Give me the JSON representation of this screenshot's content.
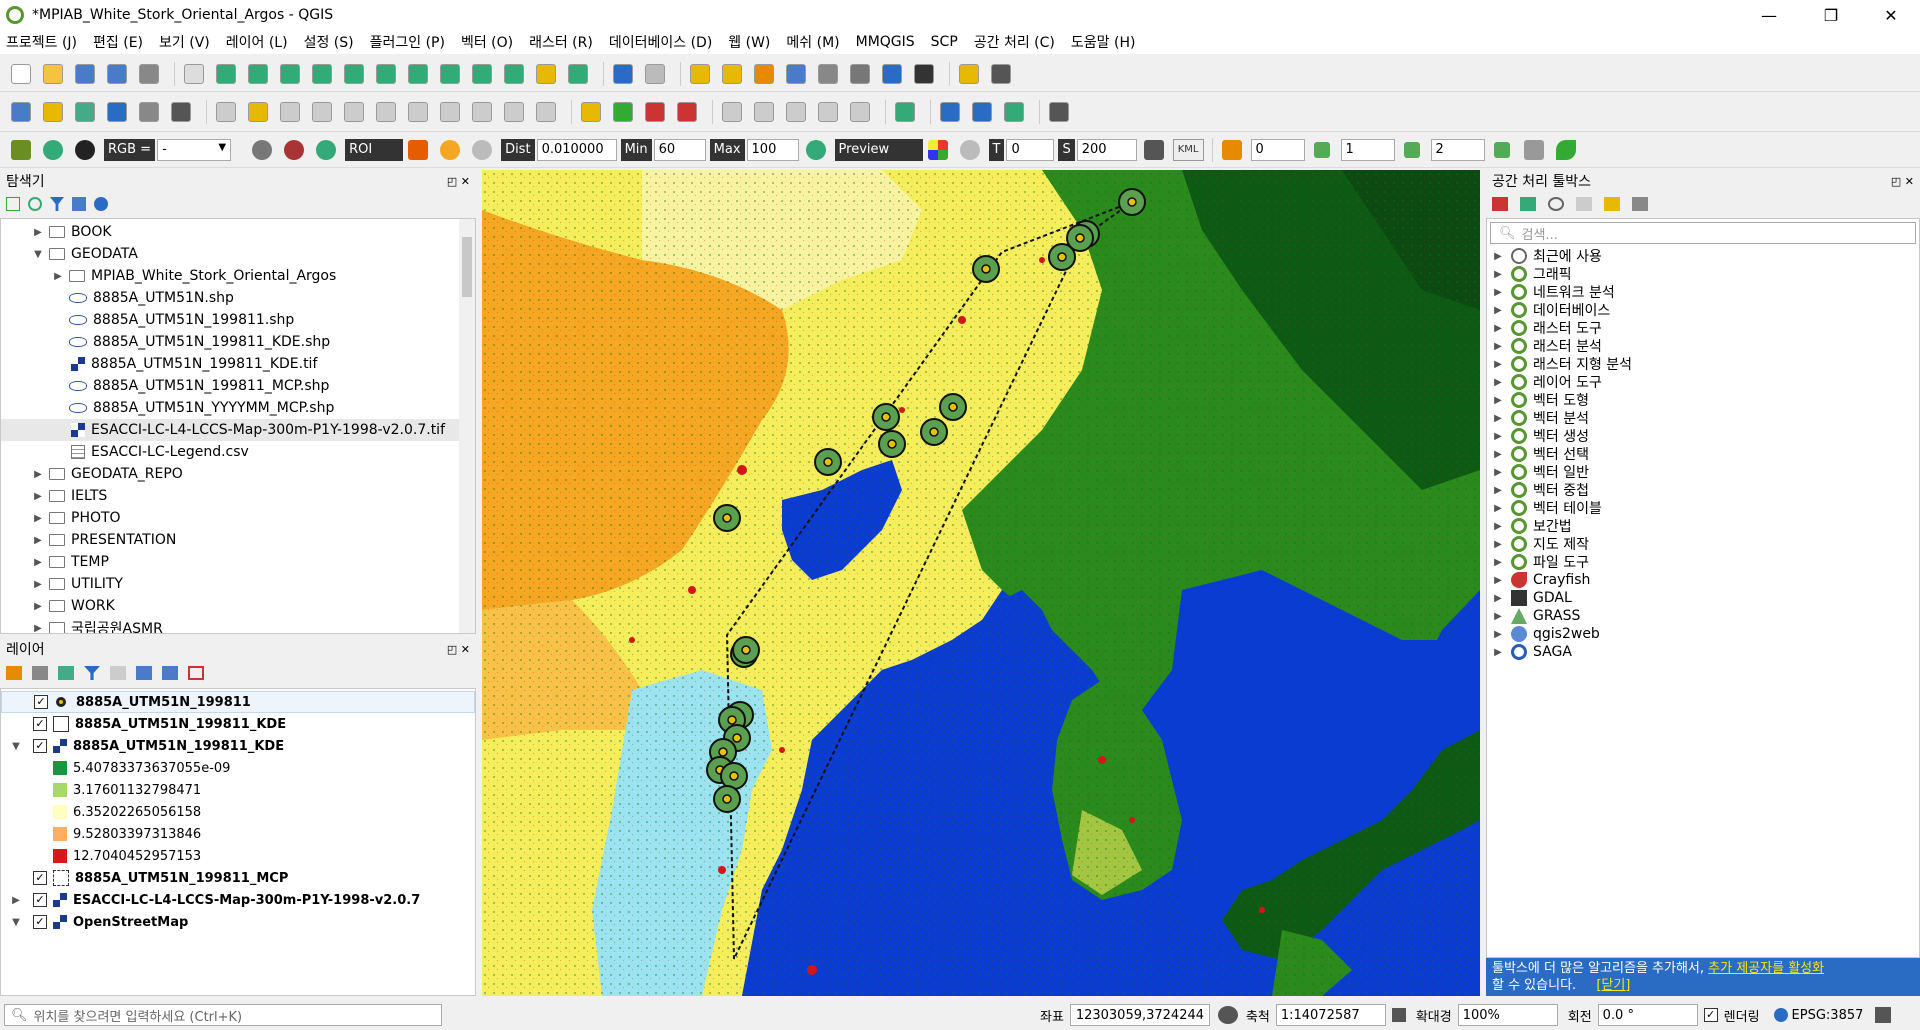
{
  "window": {
    "title": "*MPIAB_White_Stork_Oriental_Argos - QGIS"
  },
  "menu": [
    "프로젝트 (J)",
    "편집 (E)",
    "보기 (V)",
    "레이어 (L)",
    "설정 (S)",
    "플러그인 (P)",
    "벡터 (O)",
    "래스터 (R)",
    "데이터베이스 (D)",
    "웹 (W)",
    "메쉬 (M)",
    "MMQGIS",
    "SCP",
    "공간 처리 (C)",
    "도움말 (H)"
  ],
  "scp_toolbar": {
    "rgb_label": "RGB =",
    "rgb_value": "-",
    "roi_label": "ROI",
    "dist_label": "Dist",
    "dist_value": "0.010000",
    "min_label": "Min",
    "min_value": "60",
    "max_label": "Max",
    "max_value": "100",
    "preview_label": "Preview",
    "t_label": "T",
    "t_value": "0",
    "s_label": "S",
    "s_value": "200",
    "kml_label": "KML",
    "band_a": "0",
    "band_b": "1",
    "band_c": "2"
  },
  "browser": {
    "title": "탐색기",
    "items": [
      {
        "label": "BOOK",
        "type": "folder",
        "indent": 0,
        "arrow": "▶"
      },
      {
        "label": "GEODATA",
        "type": "folder",
        "indent": 0,
        "arrow": "▼"
      },
      {
        "label": "MPIAB_White_Stork_Oriental_Argos",
        "type": "folder",
        "indent": 1,
        "arrow": "▶"
      },
      {
        "label": "8885A_UTM51N.shp",
        "type": "shp",
        "indent": 1,
        "arrow": ""
      },
      {
        "label": "8885A_UTM51N_199811.shp",
        "type": "shp",
        "indent": 1,
        "arrow": ""
      },
      {
        "label": "8885A_UTM51N_199811_KDE.shp",
        "type": "shp",
        "indent": 1,
        "arrow": ""
      },
      {
        "label": "8885A_UTM51N_199811_KDE.tif",
        "type": "tif",
        "indent": 1,
        "arrow": ""
      },
      {
        "label": "8885A_UTM51N_199811_MCP.shp",
        "type": "shp",
        "indent": 1,
        "arrow": ""
      },
      {
        "label": "8885A_UTM51N_YYYYMM_MCP.shp",
        "type": "shp",
        "indent": 1,
        "arrow": ""
      },
      {
        "label": "ESACCI-LC-L4-LCCS-Map-300m-P1Y-1998-v2.0.7.tif",
        "type": "tif",
        "indent": 1,
        "arrow": "",
        "selected": true
      },
      {
        "label": "ESACCI-LC-Legend.csv",
        "type": "csv",
        "indent": 1,
        "arrow": ""
      },
      {
        "label": "GEODATA_REPO",
        "type": "folder",
        "indent": 0,
        "arrow": "▶"
      },
      {
        "label": "IELTS",
        "type": "folder",
        "indent": 0,
        "arrow": "▶"
      },
      {
        "label": "PHOTO",
        "type": "folder",
        "indent": 0,
        "arrow": "▶"
      },
      {
        "label": "PRESENTATION",
        "type": "folder",
        "indent": 0,
        "arrow": "▶"
      },
      {
        "label": "TEMP",
        "type": "folder",
        "indent": 0,
        "arrow": "▶"
      },
      {
        "label": "UTILITY",
        "type": "folder",
        "indent": 0,
        "arrow": "▶"
      },
      {
        "label": "WORK",
        "type": "folder",
        "indent": 0,
        "arrow": "▶"
      },
      {
        "label": "국립공원ASMR",
        "type": "folder",
        "indent": 0,
        "arrow": "▶"
      }
    ]
  },
  "layers": {
    "title": "레이어",
    "items": [
      {
        "label": "8885A_UTM51N_199811",
        "kind": "point",
        "arrow": "",
        "checked": true,
        "selected": true
      },
      {
        "label": "8885A_UTM51N_199811_KDE",
        "kind": "poly",
        "arrow": "",
        "checked": true
      },
      {
        "label": "8885A_UTM51N_199811_KDE",
        "kind": "raster",
        "arrow": "▼",
        "checked": true
      },
      {
        "label": "5.40783373637055e-09",
        "kind": "legend",
        "color": "#1a9641"
      },
      {
        "label": "3.17601132798471",
        "kind": "legend",
        "color": "#a6d96a"
      },
      {
        "label": "6.35202265056158",
        "kind": "legend",
        "color": "#ffffc0"
      },
      {
        "label": "9.52803397313846",
        "kind": "legend",
        "color": "#fdae61"
      },
      {
        "label": "12.7040452957153",
        "kind": "legend",
        "color": "#d7191c"
      },
      {
        "label": "8885A_UTM51N_199811_MCP",
        "kind": "dashed",
        "arrow": "",
        "checked": true
      },
      {
        "label": "ESACCI-LC-L4-LCCS-Map-300m-P1Y-1998-v2.0.7",
        "kind": "raster",
        "arrow": "▶",
        "checked": true
      },
      {
        "label": "OpenStreetMap",
        "kind": "raster",
        "arrow": "▼",
        "checked": true
      }
    ]
  },
  "toolbox": {
    "title": "공간 처리 툴박스",
    "search_placeholder": "검색...",
    "items": [
      {
        "label": "최근에 사용",
        "icon": "clock"
      },
      {
        "label": "그래픽",
        "icon": "q"
      },
      {
        "label": "네트워크 분석",
        "icon": "q"
      },
      {
        "label": "데이터베이스",
        "icon": "q"
      },
      {
        "label": "래스터 도구",
        "icon": "q"
      },
      {
        "label": "래스터 분석",
        "icon": "q"
      },
      {
        "label": "래스터 지형 분석",
        "icon": "q"
      },
      {
        "label": "레이어 도구",
        "icon": "q"
      },
      {
        "label": "벡터 도형",
        "icon": "q"
      },
      {
        "label": "벡터 분석",
        "icon": "q"
      },
      {
        "label": "벡터 생성",
        "icon": "q"
      },
      {
        "label": "벡터 선택",
        "icon": "q"
      },
      {
        "label": "벡터 일반",
        "icon": "q"
      },
      {
        "label": "벡터 중첩",
        "icon": "q"
      },
      {
        "label": "벡터 테이블",
        "icon": "q"
      },
      {
        "label": "보간법",
        "icon": "q"
      },
      {
        "label": "지도 제작",
        "icon": "q"
      },
      {
        "label": "파일 도구",
        "icon": "q"
      },
      {
        "label": "Crayfish",
        "icon": "crayfish"
      },
      {
        "label": "GDAL",
        "icon": "gdal"
      },
      {
        "label": "GRASS",
        "icon": "grass"
      },
      {
        "label": "qgis2web",
        "icon": "qgis2web"
      },
      {
        "label": "SAGA",
        "icon": "saga"
      }
    ],
    "notice_text": "툴박스에 더 많은 알고리즘을 추가해서,",
    "notice_link": "추가 제공자를 활성화",
    "notice_text2": "할 수 있습니다.",
    "notice_close": "[닫기]"
  },
  "status": {
    "locate_placeholder": "위치를 찾으려면 입력하세요 (Ctrl+K)",
    "coord_label": "좌표",
    "coord_value": "12303059,3724244",
    "scale_label": "축척",
    "scale_value": "1:14072587",
    "magnifier_label": "확대경",
    "magnifier_value": "100%",
    "rotation_label": "회전",
    "rotation_value": "0.0 °",
    "render_label": "렌더링",
    "crs": "EPSG:3857"
  },
  "colors": {
    "sea": "#0a3cd2",
    "forest": "#2a8a1c",
    "crop": "#f4ee5c",
    "grass": "#f5a623",
    "urban": "#d4151a",
    "track": "#5aa050"
  }
}
